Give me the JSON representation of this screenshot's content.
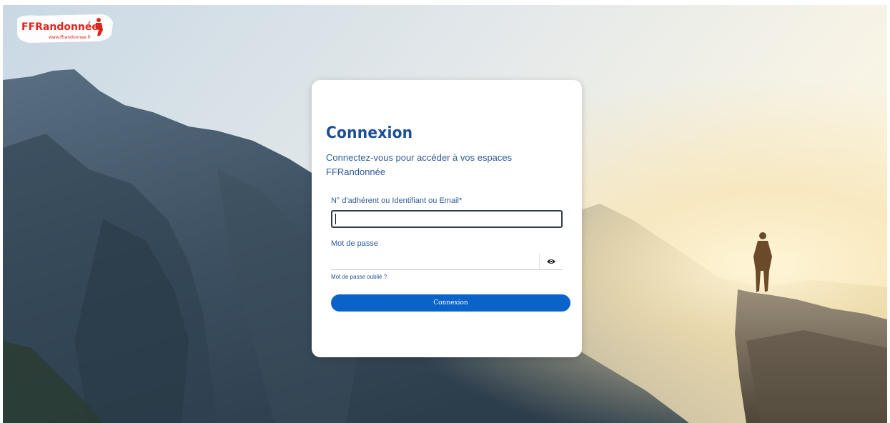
{
  "brand": {
    "name": "FFRandonnée",
    "url": "www.ffrandonnee.fr"
  },
  "login": {
    "title": "Connexion",
    "subtitle": "Connectez-vous pour accéder à vos espaces FFRandonnée",
    "username_label": "N° d'adhérent ou Identifiant ou Email*",
    "username_value": "",
    "password_label": "Mot de passe",
    "password_value": "",
    "forgot_link": "Mot de passe oublié ?",
    "submit_label": "Connexion"
  },
  "icons": {
    "password_toggle": "eye-icon"
  },
  "colors": {
    "title": "#1d4f99",
    "button": "#0a63c9",
    "brand_red": "#e2231a"
  }
}
